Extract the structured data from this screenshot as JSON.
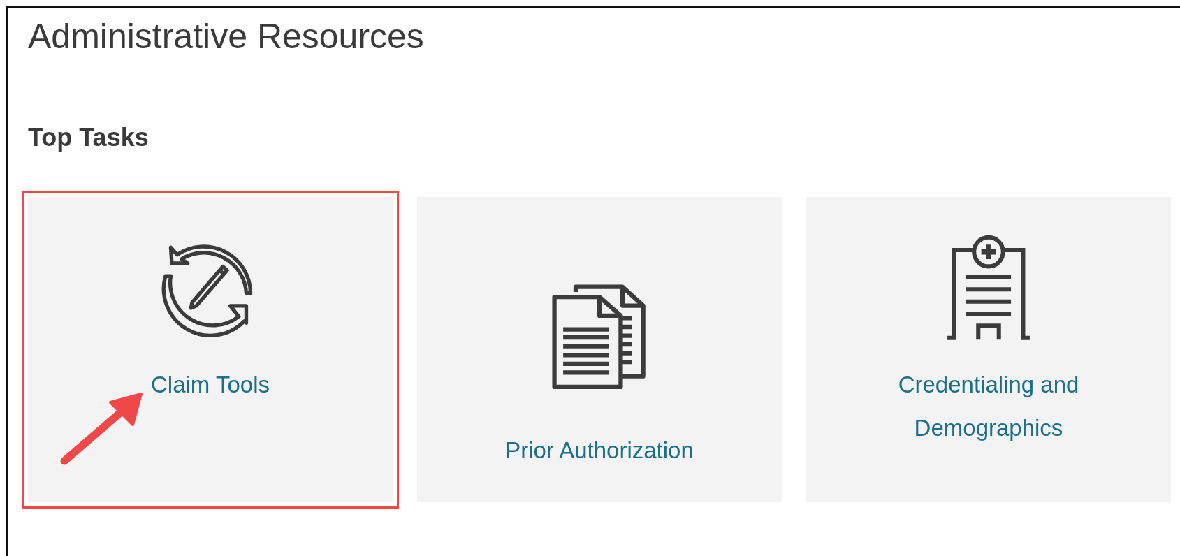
{
  "heading": "Administrative Resources",
  "section_title": "Top Tasks",
  "tasks": [
    {
      "kind": "claim",
      "label": "Claim Tools",
      "highlighted": true
    },
    {
      "kind": "documents",
      "label": "Prior Authorization",
      "highlighted": false
    },
    {
      "kind": "clipboard",
      "label": "Credentialing and Demographics",
      "highlighted": false
    }
  ]
}
